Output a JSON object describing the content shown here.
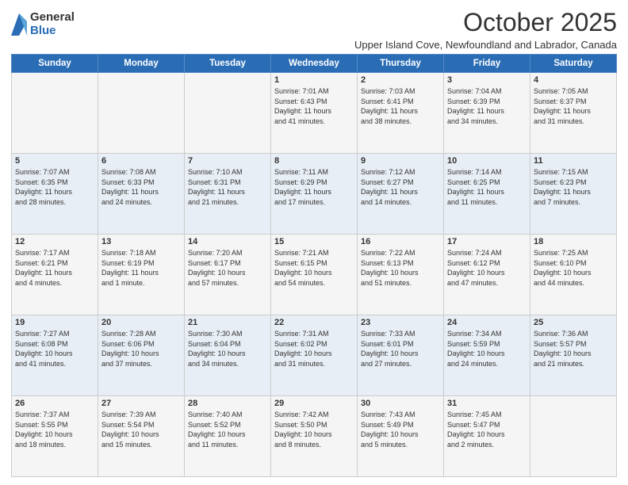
{
  "logo": {
    "general": "General",
    "blue": "Blue"
  },
  "header": {
    "month": "October 2025",
    "subtitle": "Upper Island Cove, Newfoundland and Labrador, Canada"
  },
  "days_of_week": [
    "Sunday",
    "Monday",
    "Tuesday",
    "Wednesday",
    "Thursday",
    "Friday",
    "Saturday"
  ],
  "weeks": [
    [
      {
        "day": "",
        "info": ""
      },
      {
        "day": "",
        "info": ""
      },
      {
        "day": "",
        "info": ""
      },
      {
        "day": "1",
        "info": "Sunrise: 7:01 AM\nSunset: 6:43 PM\nDaylight: 11 hours\nand 41 minutes."
      },
      {
        "day": "2",
        "info": "Sunrise: 7:03 AM\nSunset: 6:41 PM\nDaylight: 11 hours\nand 38 minutes."
      },
      {
        "day": "3",
        "info": "Sunrise: 7:04 AM\nSunset: 6:39 PM\nDaylight: 11 hours\nand 34 minutes."
      },
      {
        "day": "4",
        "info": "Sunrise: 7:05 AM\nSunset: 6:37 PM\nDaylight: 11 hours\nand 31 minutes."
      }
    ],
    [
      {
        "day": "5",
        "info": "Sunrise: 7:07 AM\nSunset: 6:35 PM\nDaylight: 11 hours\nand 28 minutes."
      },
      {
        "day": "6",
        "info": "Sunrise: 7:08 AM\nSunset: 6:33 PM\nDaylight: 11 hours\nand 24 minutes."
      },
      {
        "day": "7",
        "info": "Sunrise: 7:10 AM\nSunset: 6:31 PM\nDaylight: 11 hours\nand 21 minutes."
      },
      {
        "day": "8",
        "info": "Sunrise: 7:11 AM\nSunset: 6:29 PM\nDaylight: 11 hours\nand 17 minutes."
      },
      {
        "day": "9",
        "info": "Sunrise: 7:12 AM\nSunset: 6:27 PM\nDaylight: 11 hours\nand 14 minutes."
      },
      {
        "day": "10",
        "info": "Sunrise: 7:14 AM\nSunset: 6:25 PM\nDaylight: 11 hours\nand 11 minutes."
      },
      {
        "day": "11",
        "info": "Sunrise: 7:15 AM\nSunset: 6:23 PM\nDaylight: 11 hours\nand 7 minutes."
      }
    ],
    [
      {
        "day": "12",
        "info": "Sunrise: 7:17 AM\nSunset: 6:21 PM\nDaylight: 11 hours\nand 4 minutes."
      },
      {
        "day": "13",
        "info": "Sunrise: 7:18 AM\nSunset: 6:19 PM\nDaylight: 11 hours\nand 1 minute."
      },
      {
        "day": "14",
        "info": "Sunrise: 7:20 AM\nSunset: 6:17 PM\nDaylight: 10 hours\nand 57 minutes."
      },
      {
        "day": "15",
        "info": "Sunrise: 7:21 AM\nSunset: 6:15 PM\nDaylight: 10 hours\nand 54 minutes."
      },
      {
        "day": "16",
        "info": "Sunrise: 7:22 AM\nSunset: 6:13 PM\nDaylight: 10 hours\nand 51 minutes."
      },
      {
        "day": "17",
        "info": "Sunrise: 7:24 AM\nSunset: 6:12 PM\nDaylight: 10 hours\nand 47 minutes."
      },
      {
        "day": "18",
        "info": "Sunrise: 7:25 AM\nSunset: 6:10 PM\nDaylight: 10 hours\nand 44 minutes."
      }
    ],
    [
      {
        "day": "19",
        "info": "Sunrise: 7:27 AM\nSunset: 6:08 PM\nDaylight: 10 hours\nand 41 minutes."
      },
      {
        "day": "20",
        "info": "Sunrise: 7:28 AM\nSunset: 6:06 PM\nDaylight: 10 hours\nand 37 minutes."
      },
      {
        "day": "21",
        "info": "Sunrise: 7:30 AM\nSunset: 6:04 PM\nDaylight: 10 hours\nand 34 minutes."
      },
      {
        "day": "22",
        "info": "Sunrise: 7:31 AM\nSunset: 6:02 PM\nDaylight: 10 hours\nand 31 minutes."
      },
      {
        "day": "23",
        "info": "Sunrise: 7:33 AM\nSunset: 6:01 PM\nDaylight: 10 hours\nand 27 minutes."
      },
      {
        "day": "24",
        "info": "Sunrise: 7:34 AM\nSunset: 5:59 PM\nDaylight: 10 hours\nand 24 minutes."
      },
      {
        "day": "25",
        "info": "Sunrise: 7:36 AM\nSunset: 5:57 PM\nDaylight: 10 hours\nand 21 minutes."
      }
    ],
    [
      {
        "day": "26",
        "info": "Sunrise: 7:37 AM\nSunset: 5:55 PM\nDaylight: 10 hours\nand 18 minutes."
      },
      {
        "day": "27",
        "info": "Sunrise: 7:39 AM\nSunset: 5:54 PM\nDaylight: 10 hours\nand 15 minutes."
      },
      {
        "day": "28",
        "info": "Sunrise: 7:40 AM\nSunset: 5:52 PM\nDaylight: 10 hours\nand 11 minutes."
      },
      {
        "day": "29",
        "info": "Sunrise: 7:42 AM\nSunset: 5:50 PM\nDaylight: 10 hours\nand 8 minutes."
      },
      {
        "day": "30",
        "info": "Sunrise: 7:43 AM\nSunset: 5:49 PM\nDaylight: 10 hours\nand 5 minutes."
      },
      {
        "day": "31",
        "info": "Sunrise: 7:45 AM\nSunset: 5:47 PM\nDaylight: 10 hours\nand 2 minutes."
      },
      {
        "day": "",
        "info": ""
      }
    ]
  ]
}
